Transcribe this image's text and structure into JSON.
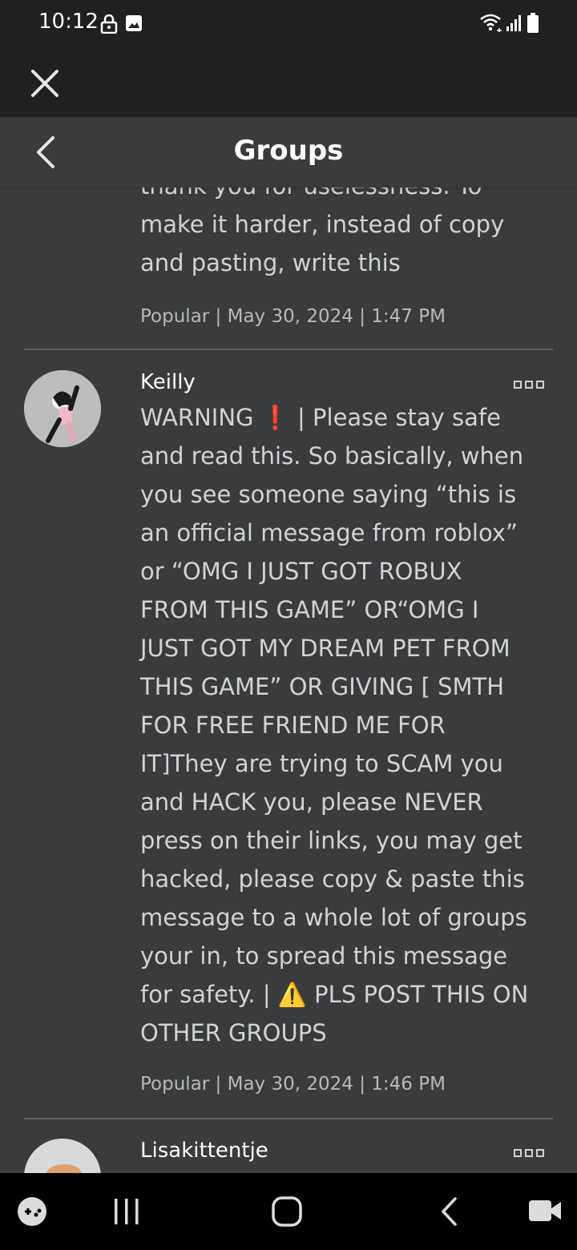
{
  "status_bar": {
    "time": "10:12",
    "icons": [
      "lock-icon",
      "image-icon",
      "wifi-icon",
      "signal-icon",
      "battery-icon"
    ]
  },
  "header": {
    "title": "Groups"
  },
  "posts": [
    {
      "body": "thank you for uselessness. To\nmake it harder, instead of copy\nand pasting, write this",
      "meta": "Popular | May 30, 2024 | 1:47 PM"
    },
    {
      "username": "Keilly",
      "body": "WARNING ❗ | Please stay safe\nand read this. So basically, when\nyou see someone saying “this is\nan official message from roblox”\nor “OMG I JUST GOT ROBUX\nFROM THIS GAME” OR“OMG I\nJUST GOT MY DREAM PET FROM\nTHIS GAME” OR GIVING [ SMTH\nFOR FREE FRIEND ME FOR\nIT]They are trying to SCAM you\nand HACK you, please NEVER\npress on their links, you may get\nhacked, please copy & paste this\nmessage to a whole lot of groups\nyour in, to spread this message\nfor safety. | ⚠️ PLS POST THIS ON\nOTHER GROUPS",
      "meta": "Popular | May 30, 2024 | 1:46 PM"
    },
    {
      "username": "Lisakittentje"
    }
  ],
  "nav_bar": {
    "icons": [
      "game-launcher-icon",
      "recent-apps-icon",
      "home-icon",
      "back-icon",
      "video-icon"
    ]
  },
  "colors": {
    "background": "#393b3d",
    "topbar": "#1f2022",
    "text": "#d2d3d4",
    "meta": "#b8b9ba",
    "divider": "#5d5f61"
  }
}
